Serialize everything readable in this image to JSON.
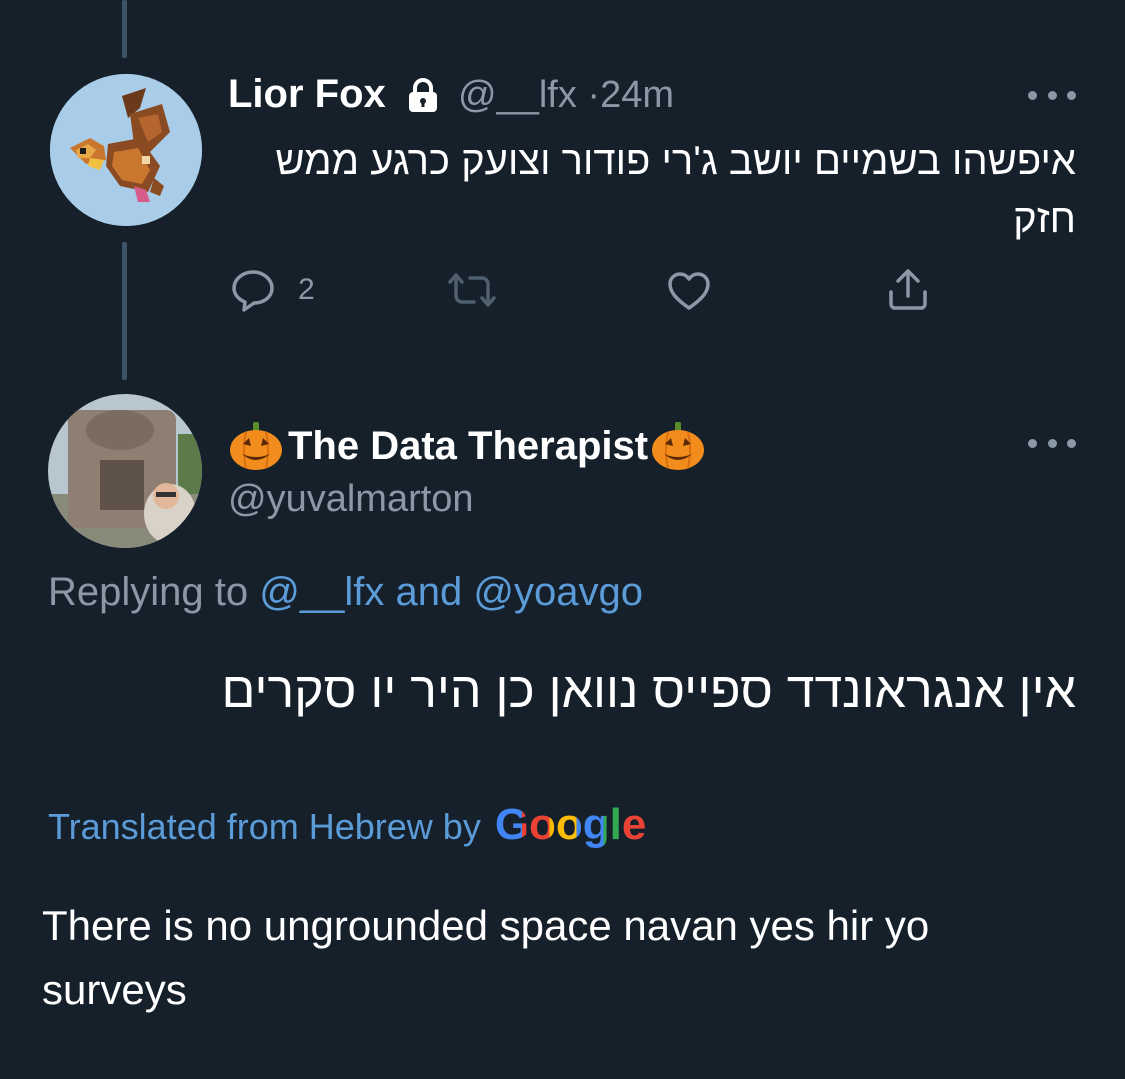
{
  "tweet1": {
    "display_name": "Lior Fox",
    "lock_icon": "lock-icon",
    "handle": "@__lfx",
    "separator": "·",
    "time": "24m",
    "text": "איפשהו בשמיים יושב ג'רי פודור וצועק כרגע ממש חזק",
    "actions": {
      "reply_count": "2",
      "reply_icon": "reply-icon",
      "retweet_icon": "retweet-icon",
      "like_icon": "heart-icon",
      "share_icon": "share-icon"
    }
  },
  "tweet2": {
    "emoji_icon": "pumpkin-emoji-icon",
    "display_name": "The Data Therapist",
    "handle": "@yuvalmarton",
    "replying_prefix": "Replying to",
    "replying_user1": "@__lfx",
    "replying_and": "and",
    "replying_user2": "@yoavgo",
    "text": "אין אנגראונדד ספייס נוואן כן היר יו סקרים",
    "translated_prefix": "Translated from Hebrew by",
    "translated_brand": "Google",
    "translation": "There is no ungrounded space navan yes hir yo surveys"
  },
  "colors": {
    "background": "#15202b",
    "secondary_text": "#8b98a5",
    "link": "#5b9bd8",
    "thread_line": "#3d5466"
  }
}
